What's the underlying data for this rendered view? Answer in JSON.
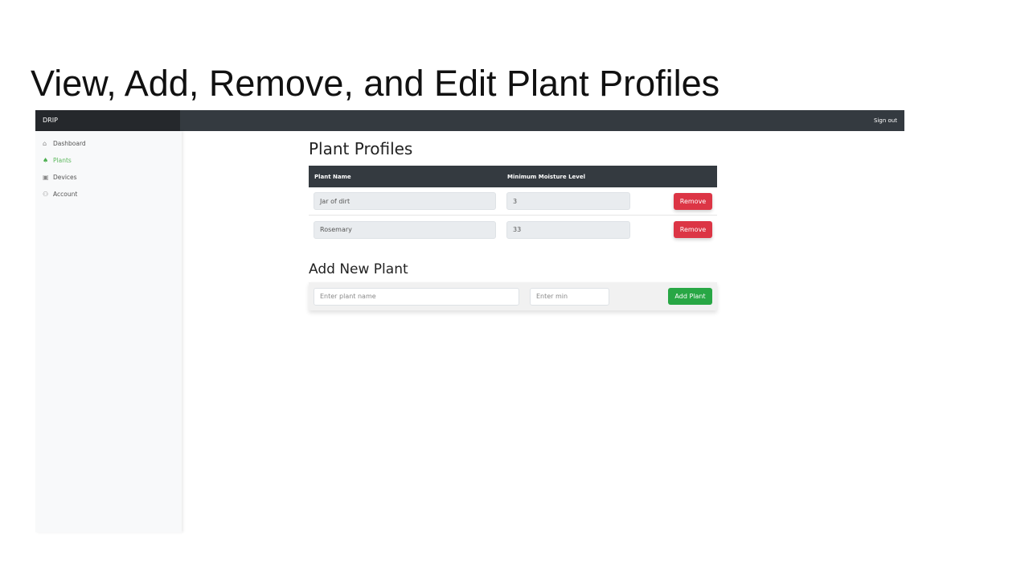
{
  "slide_title": "View, Add, Remove, and Edit Plant Profiles",
  "app": {
    "brand": "DRIP",
    "sign_out": "Sign out"
  },
  "sidebar": {
    "items": [
      {
        "label": "Dashboard",
        "icon": "home-icon"
      },
      {
        "label": "Plants",
        "icon": "leaf-icon",
        "active": true
      },
      {
        "label": "Devices",
        "icon": "chip-icon"
      },
      {
        "label": "Account",
        "icon": "users-icon"
      }
    ]
  },
  "main": {
    "title": "Plant Profiles",
    "columns": [
      "Plant Name",
      "Minimum Moisture Level"
    ],
    "rows": [
      {
        "name": "Jar of dirt",
        "min": "3",
        "action": "Remove"
      },
      {
        "name": "Rosemary",
        "min": "33",
        "action": "Remove"
      }
    ],
    "add": {
      "title": "Add New Plant",
      "name_placeholder": "Enter plant name",
      "min_placeholder": "Enter min",
      "button": "Add Plant"
    }
  },
  "colors": {
    "accent": "#5cb85c",
    "danger": "#dc3545",
    "success": "#28a745",
    "navbar": "#343a40"
  }
}
